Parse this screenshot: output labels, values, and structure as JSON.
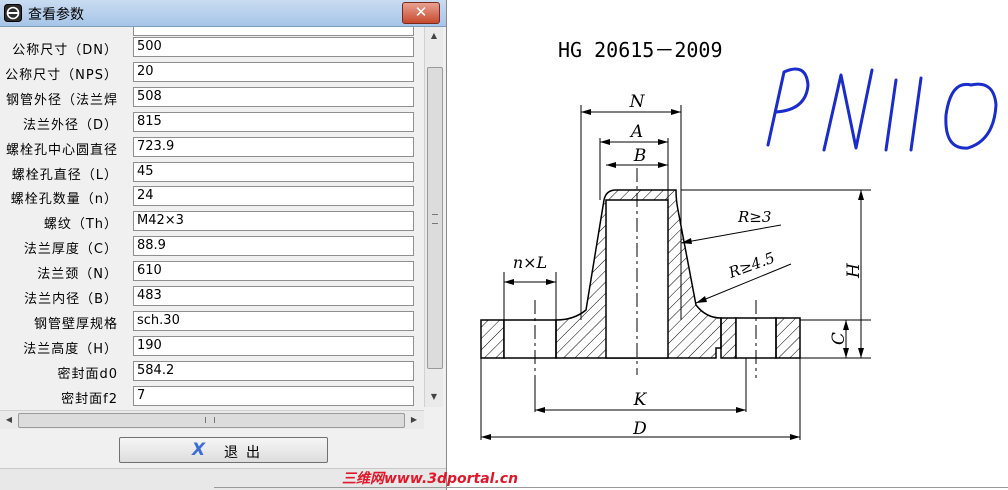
{
  "window": {
    "title": "查看参数",
    "close_label": "✕"
  },
  "fields": [
    {
      "label": "公称尺寸（DN）",
      "value": "500"
    },
    {
      "label": "公称尺寸（NPS）",
      "value": "20"
    },
    {
      "label": "钢管外径（法兰焊",
      "value": "508"
    },
    {
      "label": "法兰外径（D）",
      "value": "815"
    },
    {
      "label": "螺栓孔中心圆直径",
      "value": "723.9"
    },
    {
      "label": "螺栓孔直径（L）",
      "value": "45"
    },
    {
      "label": "螺栓孔数量（n）",
      "value": "24"
    },
    {
      "label": "螺纹（Th）",
      "value": "M42×3"
    },
    {
      "label": "法兰厚度（C）",
      "value": "88.9"
    },
    {
      "label": "法兰颈（N）",
      "value": "610"
    },
    {
      "label": "法兰内径（B）",
      "value": "483"
    },
    {
      "label": "钢管壁厚规格",
      "value": "sch.30"
    },
    {
      "label": "法兰高度（H）",
      "value": "190"
    },
    {
      "label": "密封面d0",
      "value": "584.2"
    },
    {
      "label": "密封面f2",
      "value": "7"
    }
  ],
  "exit_button": {
    "icon": "x-icon",
    "label": "退出",
    "icon_glyph": "X"
  },
  "drawing": {
    "standard": "HG 20615－2009",
    "pressure_handwritten": "PN110",
    "labels": {
      "N": "N",
      "A": "A",
      "B": "B",
      "r1": "R≥3",
      "r2": "R≥4.5",
      "nxl": "n×L",
      "H": "H",
      "C": "C",
      "K": "K",
      "D": "D"
    }
  },
  "watermark": "三维网www.3dportal.cn",
  "colors": {
    "title_bar": "#b8d1ee",
    "close_button": "#c74a2e",
    "exit_icon": "#3a6fd8",
    "handwriting": "#1a2ccc",
    "watermark": "#e0182a"
  }
}
